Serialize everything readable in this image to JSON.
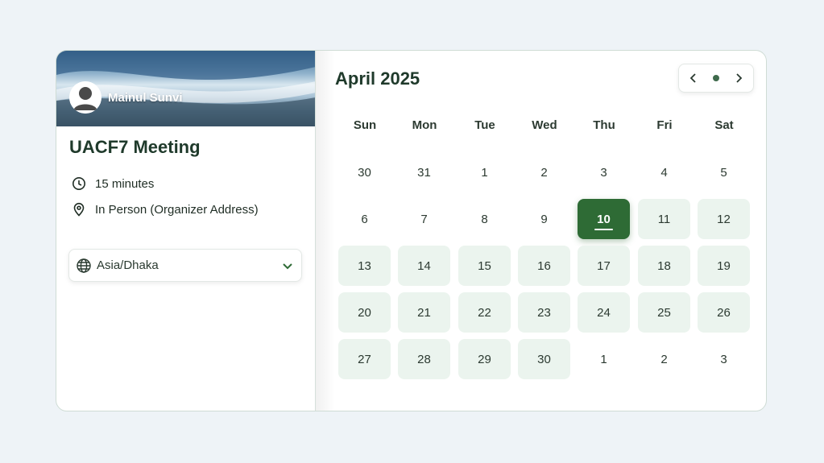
{
  "host": {
    "name": "Mainul Sunvi"
  },
  "event": {
    "title": "UACF7 Meeting",
    "duration": "15 minutes",
    "location": "In Person (Organizer Address)"
  },
  "timezone": {
    "selected": "Asia/Dhaka"
  },
  "calendar": {
    "month_label": "April 2025",
    "weekdays": [
      "Sun",
      "Mon",
      "Tue",
      "Wed",
      "Thu",
      "Fri",
      "Sat"
    ],
    "weeks": [
      [
        {
          "d": "30",
          "s": "other"
        },
        {
          "d": "31",
          "s": "other"
        },
        {
          "d": "1",
          "s": "plain"
        },
        {
          "d": "2",
          "s": "plain"
        },
        {
          "d": "3",
          "s": "plain"
        },
        {
          "d": "4",
          "s": "plain"
        },
        {
          "d": "5",
          "s": "plain"
        }
      ],
      [
        {
          "d": "6",
          "s": "plain"
        },
        {
          "d": "7",
          "s": "plain"
        },
        {
          "d": "8",
          "s": "plain"
        },
        {
          "d": "9",
          "s": "plain"
        },
        {
          "d": "10",
          "s": "selected"
        },
        {
          "d": "11",
          "s": "avail"
        },
        {
          "d": "12",
          "s": "avail"
        }
      ],
      [
        {
          "d": "13",
          "s": "avail"
        },
        {
          "d": "14",
          "s": "avail"
        },
        {
          "d": "15",
          "s": "avail"
        },
        {
          "d": "16",
          "s": "avail"
        },
        {
          "d": "17",
          "s": "avail"
        },
        {
          "d": "18",
          "s": "avail"
        },
        {
          "d": "19",
          "s": "avail"
        }
      ],
      [
        {
          "d": "20",
          "s": "avail"
        },
        {
          "d": "21",
          "s": "avail"
        },
        {
          "d": "22",
          "s": "avail"
        },
        {
          "d": "23",
          "s": "avail"
        },
        {
          "d": "24",
          "s": "avail"
        },
        {
          "d": "25",
          "s": "avail"
        },
        {
          "d": "26",
          "s": "avail"
        }
      ],
      [
        {
          "d": "27",
          "s": "avail"
        },
        {
          "d": "28",
          "s": "avail"
        },
        {
          "d": "29",
          "s": "avail"
        },
        {
          "d": "30",
          "s": "avail"
        },
        {
          "d": "1",
          "s": "other"
        },
        {
          "d": "2",
          "s": "other"
        },
        {
          "d": "3",
          "s": "other"
        }
      ]
    ]
  },
  "colors": {
    "accent": "#2e6b35",
    "available": "#ebf4ee",
    "page_bg": "#eef3f7"
  }
}
